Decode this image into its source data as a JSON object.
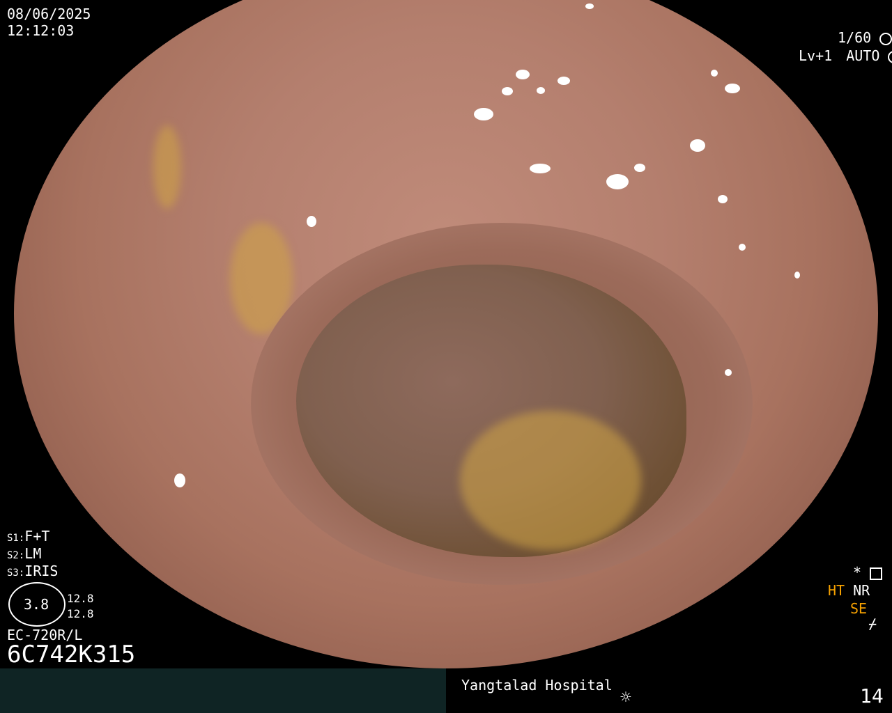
{
  "overlay": {
    "date": "08/06/2025",
    "time": "12:12:03",
    "shutter": "1/60",
    "level": "Lv+1",
    "mode": "AUTO",
    "s1_label": "S1:",
    "s1_value": "F+T",
    "s2_label": "S2:",
    "s2_value": "LM",
    "s3_label": "S3:",
    "s3_value": "IRIS",
    "gauge_value": "3.8",
    "reading_1": "12.8",
    "reading_2": "12.8",
    "scope_model": "EC-720R/L",
    "serial": "6C742K315",
    "right_status": {
      "star": "*",
      "ht": "HT",
      "nr": "NR",
      "se": "SE"
    }
  },
  "footer": {
    "hospital": "Yangtalad Hospital",
    "image_number": "14"
  },
  "colors": {
    "mucosa": "#b47f6e",
    "lumen": "#80604f",
    "footer_bar": "#0f2424",
    "orange_status": "#f5a000"
  },
  "icons": {
    "shutter": "aperture-icon",
    "auto": "iris-icon",
    "settings": "settings-icon",
    "brightness": "sun-icon",
    "light": "flash-icon"
  }
}
